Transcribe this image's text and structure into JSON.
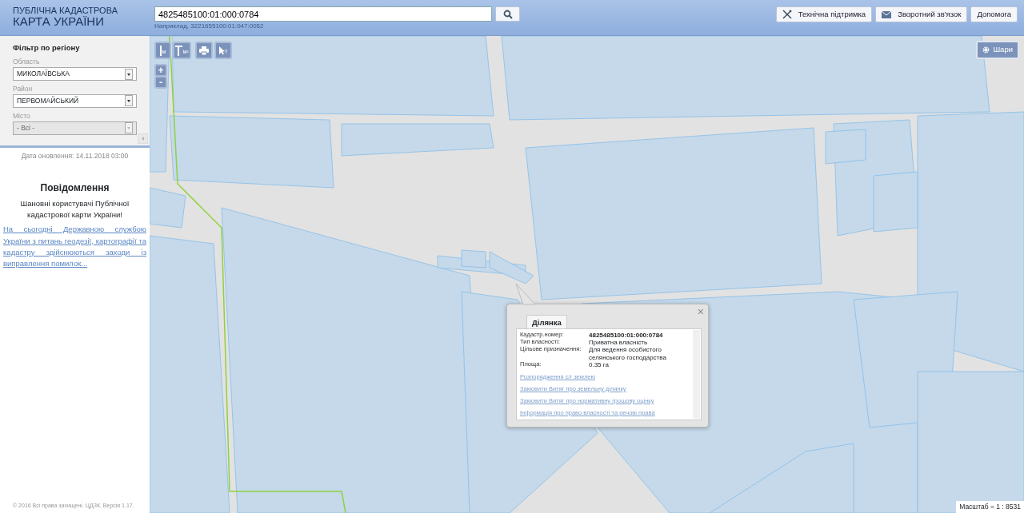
{
  "header": {
    "logo_line_1": "ПУБЛІЧНА КАДАСТРОВА",
    "logo_line_2": "КАРТА УКРАЇНИ",
    "search": {
      "value": "4825485100:01:000:0784"
    },
    "search_hint": "Наприклад, 3221655100:01:047:0052",
    "buttons": [
      {
        "kind": "tools",
        "label": "Технічна підтримка"
      },
      {
        "kind": "mail",
        "label": "Зворотний зв'язок"
      },
      {
        "kind": "plain",
        "label": "Допомога"
      }
    ]
  },
  "sidebar": {
    "filter_title": "Фільтр по регіону",
    "fields": [
      {
        "label": "Область",
        "value": "МИКОЛАЇВСЬКА",
        "disabled": false
      },
      {
        "label": "Район",
        "value": "ПЕРВОМАЙСЬКИЙ",
        "disabled": false
      },
      {
        "label": "Місто",
        "value": "- Всі -",
        "disabled": true
      }
    ],
    "update_date": "Дата оновлення: 14.11.2018 03:00",
    "notice_title": "Повідомлення",
    "notice_text": "Шановні користувачі Публічної кадастрової карти України!",
    "notice_link": "На сьогодні Державною службою України з питань геодезії, картографії та кадастру здійснюються заходи із виправлення помилок...",
    "footer": "© 2016 Всі права захищені. ЦДЗК. Версія 1.17."
  },
  "map": {
    "tools": [
      {
        "kind": "line",
        "label": "м"
      },
      {
        "kind": "area",
        "label": "м²"
      },
      {
        "kind": "print"
      },
      {
        "kind": "info",
        "label": "?"
      }
    ],
    "zoom_in": "+",
    "zoom_out": "-",
    "layers_button": "Шари",
    "popup": {
      "close": "×",
      "tabs": [
        {
          "label": "Ділянка",
          "selected": true
        }
      ],
      "fields": [
        {
          "label": "Кадастр.номер:",
          "value": "4825485100:01:000:0784",
          "bold": true
        },
        {
          "label": "Тип власності:",
          "value": "Приватна власність",
          "bold": false
        },
        {
          "label": "Цільове призначення:",
          "value": "Для ведення особистого селянського господарства",
          "bold": false
        },
        {
          "label": "Площа:",
          "value": "0.35 га",
          "bold": false
        }
      ],
      "links": [
        "Розпорядження с/г землею",
        "Замовити Витяг про земельну ділянку",
        "Замовити Витяг про нормативну грошову оцінку",
        "Інформація про право власності та речові права"
      ]
    },
    "scale": "Масштаб = 1 : 8531"
  }
}
